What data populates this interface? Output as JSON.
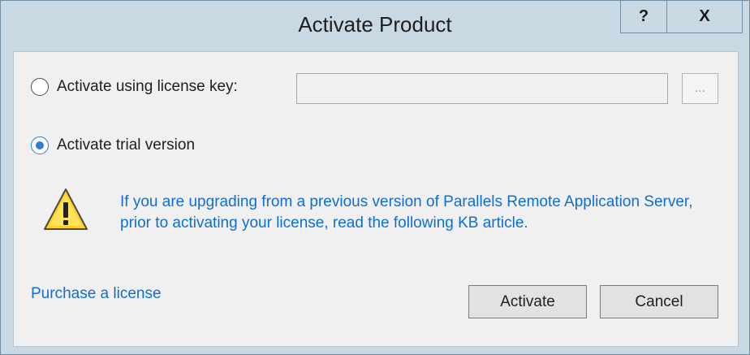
{
  "window": {
    "title": "Activate Product",
    "help_label": "?",
    "close_label": "X"
  },
  "options": {
    "license_key_label": "Activate using license key:",
    "license_key_value": "",
    "browse_label": "...",
    "trial_label": "Activate trial version",
    "selected": "trial"
  },
  "notice": {
    "icon": "warning-icon",
    "text": "If you are upgrading from a previous version of Parallels Remote Application Server, prior to activating your license, read the following KB article."
  },
  "footer": {
    "purchase_link": "Purchase a license",
    "activate_label": "Activate",
    "cancel_label": "Cancel"
  },
  "colors": {
    "link": "#0f6fd1",
    "frame": "#c8d9e3",
    "radio_selected": "#2f7bd6"
  }
}
